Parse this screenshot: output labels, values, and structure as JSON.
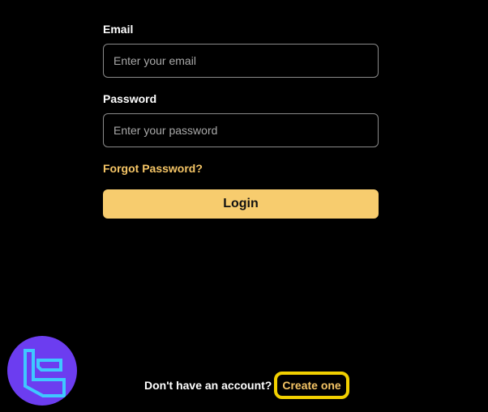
{
  "login_form": {
    "email_label": "Email",
    "email_placeholder": "Enter your email",
    "password_label": "Password",
    "password_placeholder": "Enter your password",
    "forgot_password": "Forgot Password?",
    "login_button": "Login"
  },
  "signup": {
    "prompt": "Don't have an account?",
    "link": "Create one"
  },
  "brand_logo": {
    "icon": "brand-logo-icon"
  },
  "colors": {
    "background": "#000000",
    "accent": "#f7cc6e",
    "link": "#f5c566",
    "highlight": "#f2d000",
    "logo_bg": "#6c3df0",
    "logo_mark": "#3fc8ff"
  }
}
